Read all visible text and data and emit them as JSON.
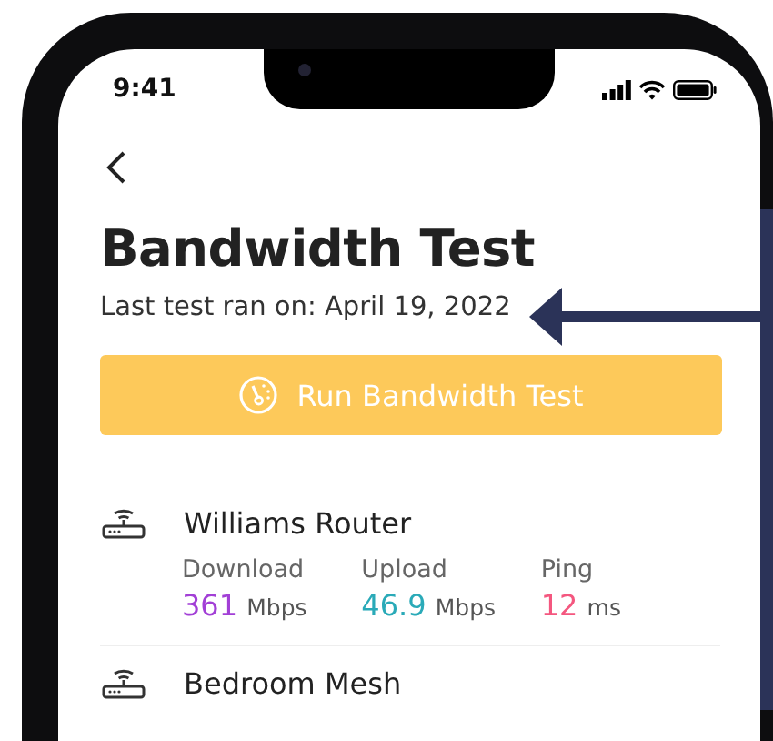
{
  "status_bar": {
    "time": "9:41"
  },
  "header": {
    "title": "Bandwidth Test",
    "subtitle": "Last test ran on: April 19, 2022"
  },
  "run_button": {
    "label": "Run Bandwidth Test"
  },
  "devices": [
    {
      "name": "Williams Router",
      "metrics": [
        {
          "label": "Download",
          "value": "361",
          "unit": "Mbps",
          "color": "#a23fd6"
        },
        {
          "label": "Upload",
          "value": "46.9",
          "unit": "Mbps",
          "color": "#2aaab8"
        },
        {
          "label": "Ping",
          "value": "12",
          "unit": "ms",
          "color": "#f4577f"
        }
      ]
    },
    {
      "name": "Bedroom Mesh"
    }
  ]
}
